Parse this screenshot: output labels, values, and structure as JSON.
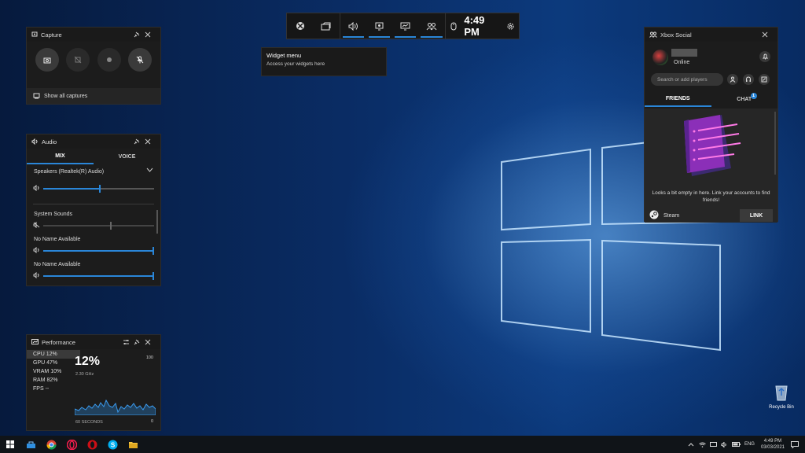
{
  "gamebar": {
    "time": "4:49 PM"
  },
  "tooltip": {
    "title": "Widget menu",
    "subtitle": "Access your widgets here"
  },
  "capture": {
    "title": "Capture",
    "show_all": "Show all captures"
  },
  "audio": {
    "title": "Audio",
    "tabs": [
      "MIX",
      "VOICE"
    ],
    "device": "Speakers (Realtek(R) Audio)",
    "device_level": 0.5,
    "apps": [
      {
        "name": "System Sounds",
        "level": 0.6,
        "muted": true
      },
      {
        "name": "No Name Available",
        "level": 1.0,
        "muted": false
      },
      {
        "name": "No Name Available",
        "level": 1.0,
        "muted": false
      }
    ]
  },
  "performance": {
    "title": "Performance",
    "metrics": [
      {
        "label": "CPU",
        "value": "12%"
      },
      {
        "label": "GPU",
        "value": "47%"
      },
      {
        "label": "VRAM",
        "value": "10%"
      },
      {
        "label": "RAM",
        "value": "82%"
      },
      {
        "label": "FPS",
        "value": "--"
      }
    ],
    "big_value": "12%",
    "freq": "2.30 GHz",
    "max": "100",
    "min": "0",
    "duration": "60 SECONDS"
  },
  "social": {
    "title": "Xbox Social",
    "status": "Online",
    "search_placeholder": "Search or add players",
    "tabs": {
      "friends": "FRIENDS",
      "chat": "CHAT",
      "chat_badge": "1"
    },
    "empty_msg": "Looks a bit empty in here. Link your accounts to find friends!",
    "steam": "Steam",
    "link": "LINK"
  },
  "desktop": {
    "recycle_bin": "Recycle Bin"
  },
  "taskbar": {
    "lang": "ENG",
    "time": "4:49 PM",
    "date": "03/03/2021"
  },
  "colors": {
    "accent": "#2a86d8",
    "panel": "#1c1c1c"
  }
}
